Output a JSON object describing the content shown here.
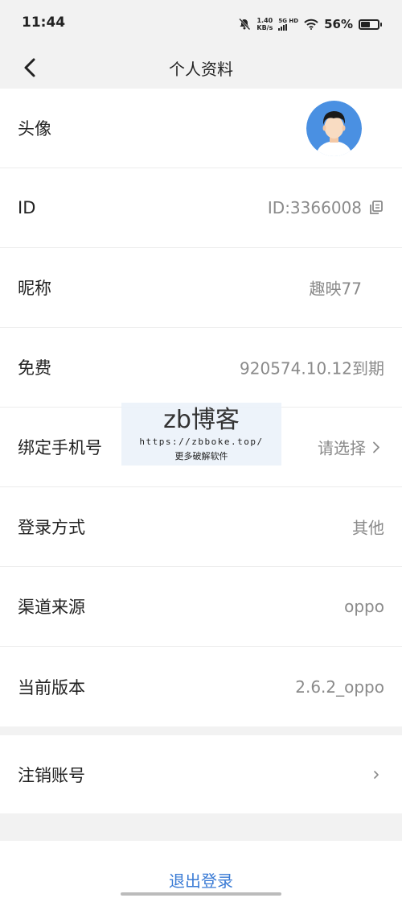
{
  "status_bar": {
    "time": "11:44",
    "net_speed_value": "1.40",
    "net_speed_unit": "KB/s",
    "network": "5G HD",
    "battery_percent": "56%",
    "battery_level": 0.56
  },
  "nav": {
    "title": "个人资料",
    "back_icon": "chevron-left-icon"
  },
  "profile": {
    "avatar_label": "头像",
    "id_label": "ID",
    "id_value": "ID:3366008",
    "nickname_label": "昵称",
    "nickname_value": "趣映77",
    "free_label": "免费",
    "free_value": "920574.10.12到期",
    "phone_label": "绑定手机号",
    "phone_value": "请选择",
    "login_method_label": "登录方式",
    "login_method_value": "其他",
    "channel_label": "渠道来源",
    "channel_value": "oppo",
    "version_label": "当前版本",
    "version_value": "2.6.2_oppo"
  },
  "account": {
    "cancel_label": "注销账号"
  },
  "logout_label": "退出登录",
  "watermark": {
    "title": "zb博客",
    "url": "https://zbboke.top/",
    "subtitle": "更多破解软件"
  },
  "colors": {
    "accent": "#3a7bd5",
    "avatar_bg": "#4a90e2",
    "page_bg": "#f2f2f2"
  }
}
